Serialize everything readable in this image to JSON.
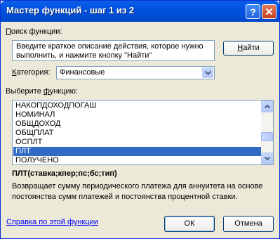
{
  "window": {
    "title": "Мастер функций - шаг 1 из 2",
    "help_glyph": "?",
    "close_glyph": "✕"
  },
  "search": {
    "label_accel": "П",
    "label_rest": "оиск функции:",
    "text": "Введите краткое описание действия, которое нужно выполнить, и нажмите кнопку \"Найти\"",
    "find_accel": "Н",
    "find_rest": "айти"
  },
  "category": {
    "label_accel": "К",
    "label_rest": "атегория:",
    "value": "Финансовые"
  },
  "function_list": {
    "label_accel": "ф",
    "label_before": "Выберите ",
    "label_after": "ункцию:",
    "items": [
      "НАКОПДОХОДПОГАШ",
      "НОМИНАЛ",
      "ОБЩДОХОД",
      "ОБЩПЛАТ",
      "ОСПЛТ",
      "ПЛТ",
      "ПОЛУЧЕНО"
    ],
    "selected_index": 5
  },
  "details": {
    "signature": "ПЛТ(ставка;кпер;пс;бс;тип)",
    "description": "Возвращает сумму периодического платежа для аннуитета на основе постоянства сумм платежей и постоянства процентной ставки."
  },
  "footer": {
    "help_link": "Справка по этой функции",
    "ok_label": "ОК",
    "cancel_label": "Отмена"
  },
  "colors": {
    "selection": "#316ac5",
    "titlebar": "#0053e1",
    "dialog_bg": "#ece9d8",
    "link": "#0000ff"
  }
}
